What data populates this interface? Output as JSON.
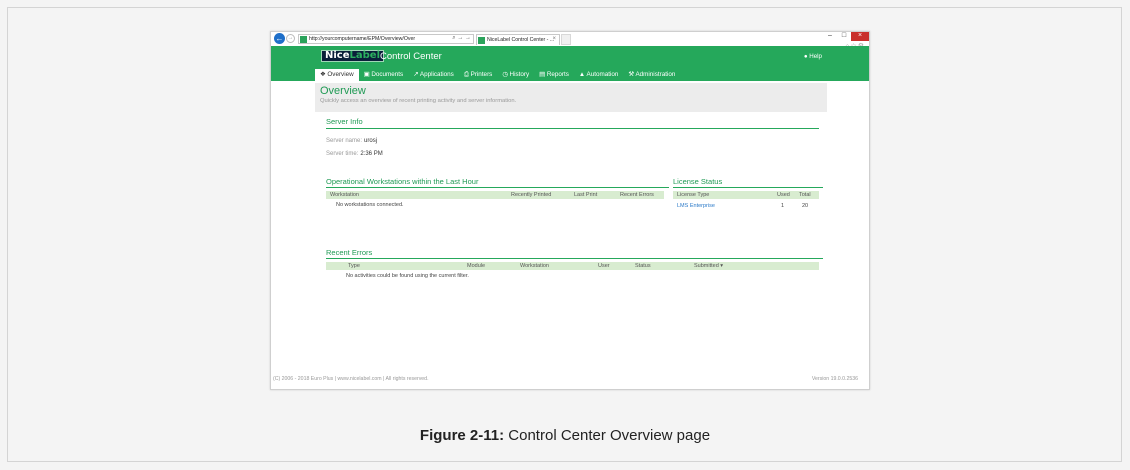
{
  "browser": {
    "url": "http://yourcomputername/EPM/Overview/Over",
    "addr_controls": "⌕ → →",
    "tab_title": "NiceLabel Control Center - ...",
    "tab_close": "×",
    "back_glyph": "←",
    "forward_glyph": "→",
    "minimize": "–",
    "maximize": "□",
    "close": "×",
    "tools": "⌂☆⚙"
  },
  "header": {
    "logo_nice": "Nice",
    "logo_label": "Label",
    "app_title": "Control Center",
    "help": "● Help"
  },
  "nav": {
    "items": [
      {
        "label": "❖ Overview"
      },
      {
        "label": "▣ Documents"
      },
      {
        "label": "↗ Applications"
      },
      {
        "label": "⎙ Printers"
      },
      {
        "label": "◷ History"
      },
      {
        "label": "▤ Reports"
      },
      {
        "label": "▲ Automation"
      },
      {
        "label": "⚒ Administration"
      }
    ]
  },
  "overview": {
    "title": "Overview",
    "subtitle": "Quickly access an overview of recent printing activity and server information."
  },
  "server_info": {
    "title": "Server Info",
    "name_label": "Server name:",
    "name_value": "urosj",
    "time_label": "Server time:",
    "time_value": "2:36 PM"
  },
  "workstations": {
    "title": "Operational Workstations within the Last Hour",
    "columns": [
      "Workstation",
      "Recently Printed",
      "Last Print",
      "Recent Errors"
    ],
    "empty": "No workstations connected."
  },
  "license": {
    "title": "License Status",
    "columns": [
      "License Type",
      "Used",
      "Total"
    ],
    "rows": [
      {
        "type": "LMS Enterprise",
        "used": "1",
        "total": "20"
      }
    ]
  },
  "recent_errors": {
    "title": "Recent Errors",
    "columns": [
      "Type",
      "Module",
      "Workstation",
      "User",
      "Status",
      "Submitted ▾"
    ],
    "empty": "No activities could be found using the current filter."
  },
  "footer": {
    "left": "(C) 2006 - 2018 Euro Plus  |  www.nicelabel.com  |  All rights reserved.",
    "right": "Version 19.0.0.2536"
  },
  "caption": {
    "figure": "Figure 2-11:",
    "text": " Control Center Overview page"
  },
  "colors": {
    "brand_green": "#25a85b",
    "header_green_text": "#1f9a54",
    "table_header": "#d8ecd0",
    "link": "#2a79c8",
    "close_red": "#c9302c"
  }
}
